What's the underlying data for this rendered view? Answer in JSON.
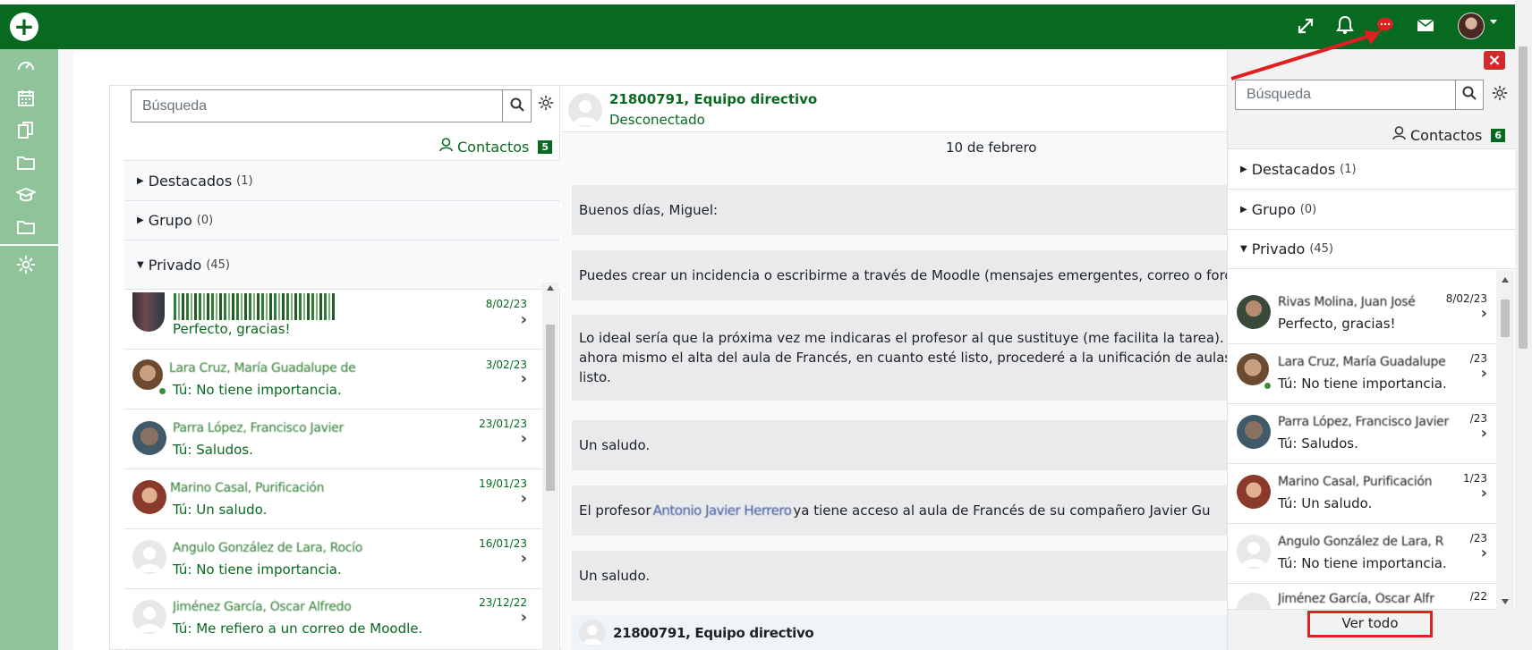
{
  "colors": {
    "brand": "#086a20",
    "sidebar": "#8fc49a",
    "highlight_box": "#e02020"
  },
  "navbar": {
    "add_icon": "plus-circle-icon",
    "icons": [
      "expand-icon",
      "bell-icon",
      "chat-icon",
      "envelope-icon",
      "user-avatar"
    ]
  },
  "sidebar": {
    "icons": [
      "dashboard-icon",
      "calendar-icon",
      "copy-icon",
      "folder-icon",
      "graduation-cap-icon",
      "folder-icon",
      "gear-icon"
    ]
  },
  "main_panel": {
    "search_placeholder": "Búsqueda",
    "contacts_label": "Contactos",
    "contacts_count": "5",
    "sections": [
      {
        "label": "Destacados",
        "count": "(1)"
      },
      {
        "label": "Grupo",
        "count": "(0)"
      },
      {
        "label": "Privado",
        "count": "(45)"
      }
    ],
    "conversations": [
      {
        "name": "",
        "date": "8/02/23",
        "message": "Perfecto, gracias!"
      },
      {
        "name": "Lara Cruz, María Guadalupe de",
        "date": "3/02/23",
        "message": "Tú: No tiene importancia."
      },
      {
        "name": "Parra López, Francisco Javier",
        "date": "23/01/23",
        "message": "Tú: Saludos."
      },
      {
        "name": "Marino Casal, Purificación",
        "date": "19/01/23",
        "message": "Tú: Un saludo."
      },
      {
        "name": "Angulo González de Lara, Rocío",
        "date": "16/01/23",
        "message": "Tú: No tiene importancia."
      },
      {
        "name": "Jiménez García, Óscar Alfredo",
        "date": "23/12/22",
        "message": "Tú: Me refiero a un correo de Moodle."
      }
    ]
  },
  "chat": {
    "contact_name": "21800791, Equipo directivo",
    "contact_status": "Desconectado",
    "date_header": "10 de febrero",
    "messages": [
      "Buenos días, Miguel:",
      "Puedes crear un incidencia o escribirme a través de Moodle (mensajes emergentes, correo o foro",
      "Lo ideal sería que la próxima vez me indicaras el profesor al que sustituye (me facilita la tarea). S",
      "ahora mismo el alta del aula de Francés, en cuanto esté listo, procederé a la unificación de aulas",
      "listo.",
      "Un saludo.",
      "El profesor",
      "Antonio Javier Herrero",
      "ya tiene acceso al aula de Francés de su compañero Javier Gu",
      "Un saludo."
    ],
    "footer_sender": "21800791, Equipo directivo"
  },
  "drawer": {
    "search_placeholder": "Búsqueda",
    "contacts_label": "Contactos",
    "contacts_count": "6",
    "sections": [
      {
        "label": "Destacados",
        "count": "(1)"
      },
      {
        "label": "Grupo",
        "count": "(0)"
      },
      {
        "label": "Privado",
        "count": "(45)"
      }
    ],
    "conversations": [
      {
        "name": "Rivas Molina, Juan José",
        "date": "8/02/23",
        "message": "Perfecto, gracias!"
      },
      {
        "name": "Lara Cruz, María Guadalupe",
        "date": "/23",
        "message": "Tú: No tiene importancia."
      },
      {
        "name": "Parra López, Francisco Javier",
        "date": "/23",
        "message": "Tú: Saludos."
      },
      {
        "name": "Marino Casal, Purificación",
        "date": "1/23",
        "message": "Tú: Un saludo."
      },
      {
        "name": "Angulo González de Lara, R",
        "date": "/23",
        "message": "Tú: No tiene importancia."
      },
      {
        "name": "Jiménez García, Óscar Alfr",
        "date": "/22",
        "message": ""
      }
    ],
    "view_all": "Ver todo"
  }
}
